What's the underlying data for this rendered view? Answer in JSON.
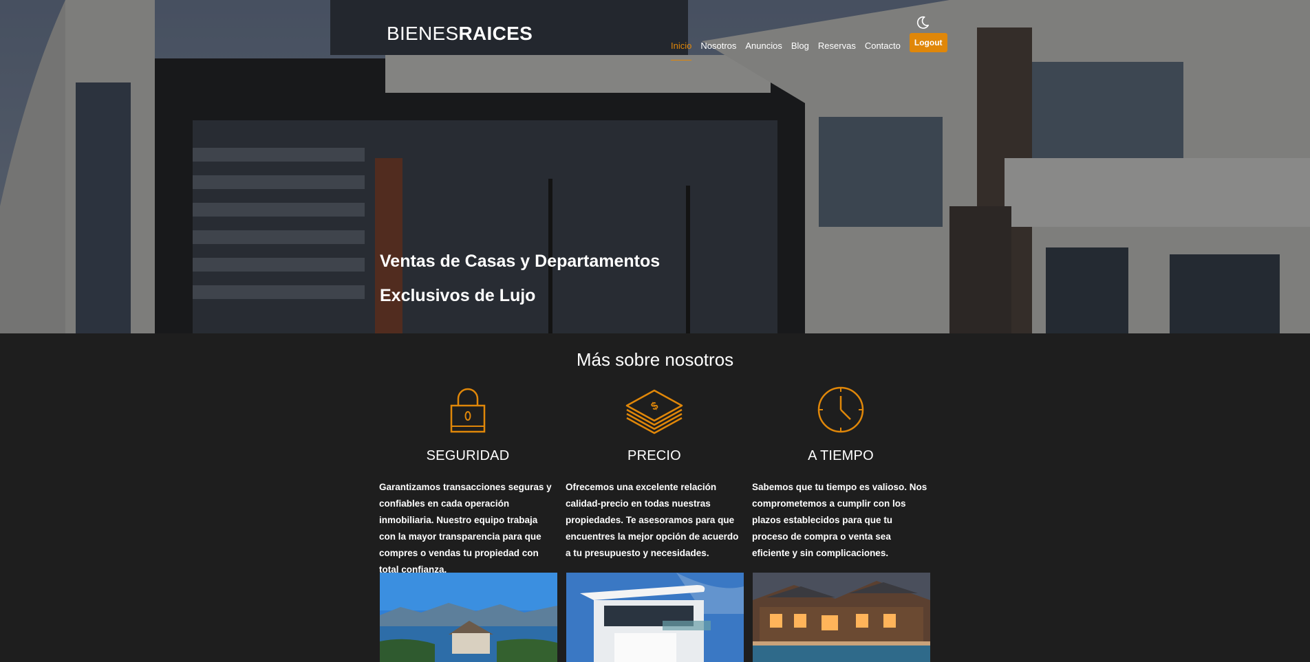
{
  "header": {
    "logo_thin": "BIENES",
    "logo_bold": "RAICES",
    "nav": [
      "Inicio",
      "Nosotros",
      "Anuncios",
      "Blog",
      "Reservas",
      "Contacto"
    ],
    "logout_label": "Logout"
  },
  "hero": {
    "title_line1": "Ventas de Casas y Departamentos",
    "title_line2": "Exclusivos de Lujo"
  },
  "about": {
    "title": "Más sobre nosotros",
    "features": [
      {
        "icon": "lock-icon",
        "title": "SEGURIDAD",
        "text": "Garantizamos transacciones seguras y confiables en cada operación inmobiliaria. Nuestro equipo trabaja con la mayor transparencia para que compres o vendas tu propiedad con total confianza."
      },
      {
        "icon": "money-icon",
        "title": "PRECIO",
        "text": "Ofrecemos una excelente relación calidad-precio en todas nuestras propiedades. Te asesoramos para que encuentres la mejor opción de acuerdo a tu presupuesto y necesidades."
      },
      {
        "icon": "clock-icon",
        "title": "A TIEMPO",
        "text": "Sabemos que tu tiempo es valioso. Nos comprometemos a cumplir con los plazos establecidos para que tu proceso de compra o venta sea eficiente y sin complicaciones."
      }
    ]
  },
  "colors": {
    "accent": "#e08709",
    "background": "#1e1e1e"
  }
}
